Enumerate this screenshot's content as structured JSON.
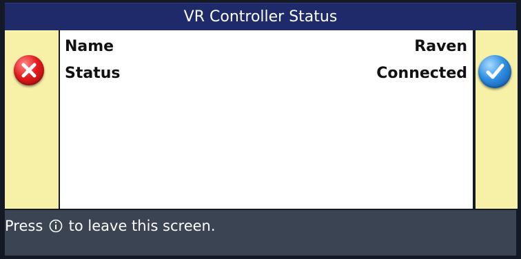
{
  "window": {
    "title": "VR Controller Status"
  },
  "fields": [
    {
      "label": "Name",
      "value": "Raven"
    },
    {
      "label": "Status",
      "value": "Connected"
    }
  ],
  "buttons": {
    "cancel_icon": "x-icon",
    "confirm_icon": "check-icon"
  },
  "footer": {
    "prefix": "Press",
    "icon": "info-icon",
    "suffix": "to leave this screen."
  },
  "colors": {
    "title_bar": "#1f2a6b",
    "side_panel": "#f7f1a8",
    "footer": "#3a4452",
    "cancel_button": "#e31b1b",
    "confirm_button": "#2f8fe3"
  }
}
